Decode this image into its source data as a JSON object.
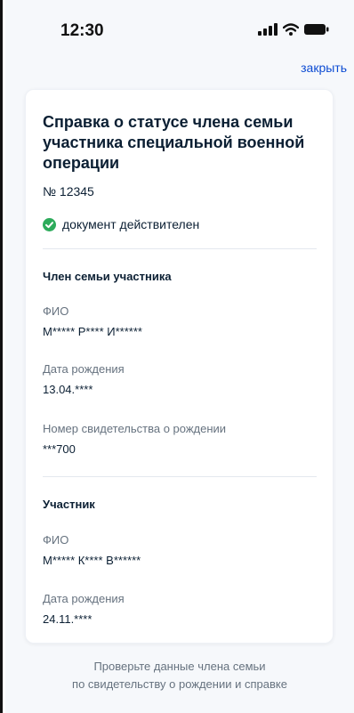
{
  "status_bar": {
    "time": "12:30",
    "icons": [
      "signal-icon",
      "wifi-icon",
      "battery-icon"
    ]
  },
  "header": {
    "close_label": "закрыть"
  },
  "card": {
    "title_lines": [
      "Справка о статусе члена семьи",
      "участника специальной военной",
      "операции"
    ],
    "doc_number": "№ 12345",
    "validity_text": "документ действителен",
    "family_member": {
      "section_title": "Член семьи участника",
      "fio_label": "ФИО",
      "fio_value": "М***** Р**** И******",
      "birth_label": "Дата рождения",
      "birth_value": "13.04.****",
      "certificate_label": "Номер свидетельства о рождении",
      "certificate_value": "***700"
    },
    "participant": {
      "section_title": "Участник",
      "fio_label": "ФИО",
      "fio_value": "М***** К**** В******",
      "birth_label": "Дата рождения",
      "birth_value": "24.11.****"
    }
  },
  "footer": {
    "note_lines": [
      "Проверьте данные члена семьи",
      "по свидетельству о рождении и справке"
    ]
  },
  "colors": {
    "accent_link": "#0d4cd3",
    "valid_green": "#2dab5b",
    "background": "#f6f8fb",
    "muted_text": "#66727f"
  }
}
